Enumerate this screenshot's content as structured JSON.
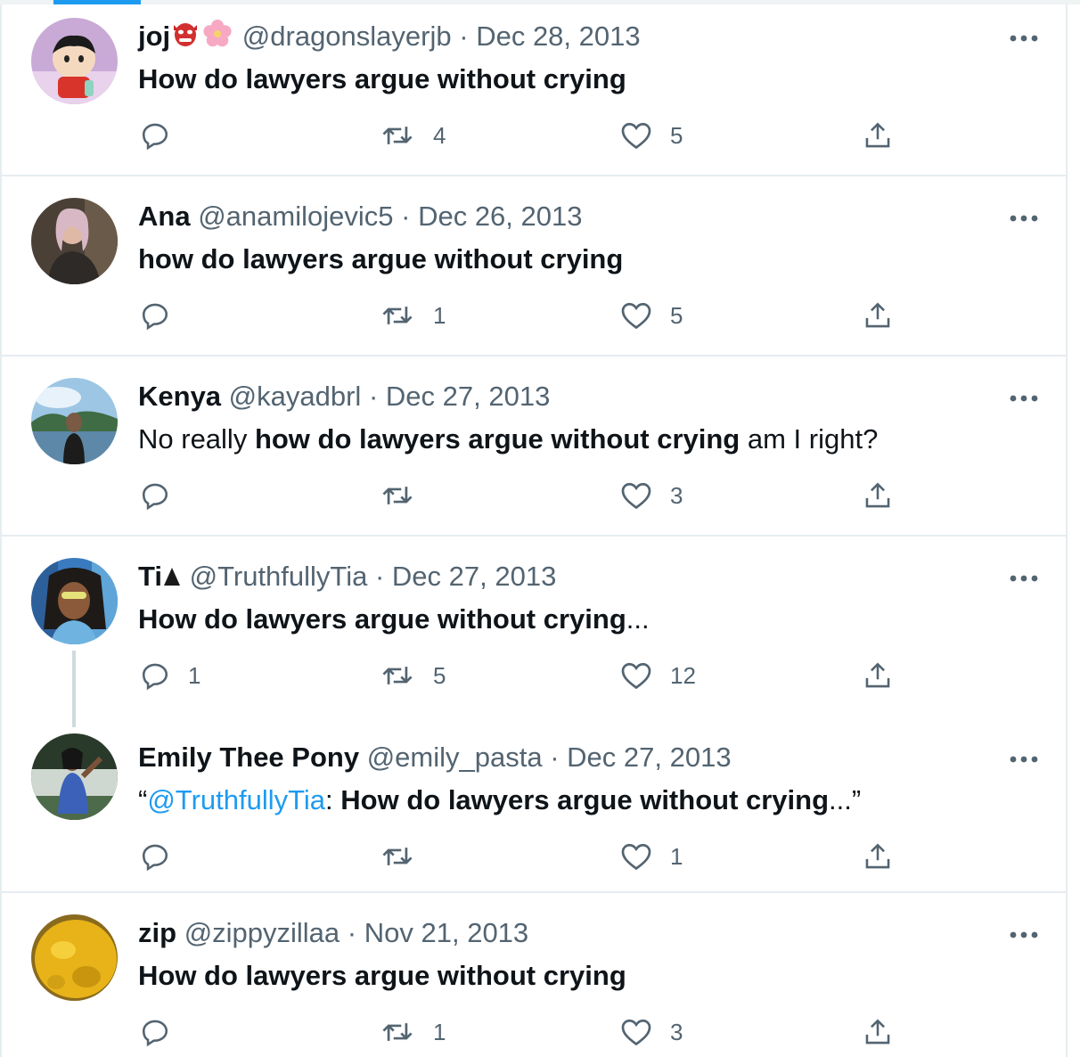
{
  "tweets": [
    {
      "name": "joj",
      "handle": "@dragonslayerjb",
      "separator": "·",
      "date": "Dec 28, 2013",
      "segments": [
        {
          "text": "How do lawyers argue without crying",
          "style": "bold"
        }
      ],
      "counts": {
        "reply": "",
        "retweet": "4",
        "like": "5"
      },
      "avatar": "cartoon-avatar"
    },
    {
      "name": "Ana",
      "handle": "@anamilojevic5",
      "separator": "·",
      "date": "Dec 26, 2013",
      "segments": [
        {
          "text": "how do lawyers argue without crying",
          "style": "bold"
        }
      ],
      "counts": {
        "reply": "",
        "retweet": "1",
        "like": "5"
      },
      "avatar": "photo-avatar"
    },
    {
      "name": "Kenya",
      "handle": "@kayadbrl",
      "separator": "·",
      "date": "Dec 27, 2013",
      "segments": [
        {
          "text": "No really ",
          "style": "normal"
        },
        {
          "text": "how do lawyers argue without crying",
          "style": "bold"
        },
        {
          "text": " am I right?",
          "style": "normal"
        }
      ],
      "counts": {
        "reply": "",
        "retweet": "",
        "like": "3"
      },
      "avatar": "lake-photo-avatar"
    },
    {
      "name": "Ti",
      "handle": "@TruthfullyTia",
      "separator": "·",
      "date": "Dec 27, 2013",
      "segments": [
        {
          "text": "How do lawyers argue without crying",
          "style": "bold"
        },
        {
          "text": "...",
          "style": "normal"
        }
      ],
      "counts": {
        "reply": "1",
        "retweet": "5",
        "like": "12"
      },
      "avatar": "portrait-avatar"
    },
    {
      "name": "Emily Thee Pony",
      "handle": "@emily_pasta",
      "separator": "·",
      "date": "Dec 27, 2013",
      "segments": [
        {
          "text": "“",
          "style": "normal"
        },
        {
          "text": "@TruthfullyTia",
          "style": "link"
        },
        {
          "text": ": ",
          "style": "normal"
        },
        {
          "text": "How do lawyers argue without crying",
          "style": "bold"
        },
        {
          "text": "...”",
          "style": "normal"
        }
      ],
      "counts": {
        "reply": "",
        "retweet": "",
        "like": "1"
      },
      "avatar": "garden-photo-avatar"
    },
    {
      "name": "zip",
      "handle": "@zippyzillaa",
      "separator": "·",
      "date": "Nov 21, 2013",
      "segments": [
        {
          "text": "How do lawyers argue without crying",
          "style": "bold"
        }
      ],
      "counts": {
        "reply": "",
        "retweet": "1",
        "like": "3"
      },
      "avatar": "yellow-creature-avatar"
    }
  ],
  "icons": {
    "reply": "reply-icon",
    "retweet": "retweet-icon",
    "like": "heart-icon",
    "share": "share-icon",
    "more": "more-options-icon"
  },
  "colors": {
    "text": "#0f1419",
    "secondary": "#536471",
    "link": "#1d9bf0",
    "divider": "#e6ecf0"
  }
}
